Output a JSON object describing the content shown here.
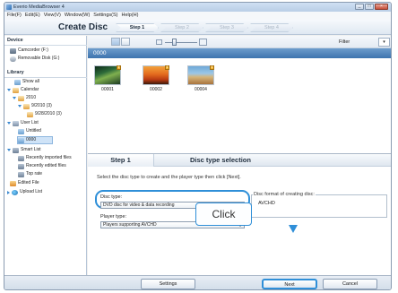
{
  "window": {
    "title": "Everio MediaBrowser 4",
    "controls": {
      "minimize": "_",
      "maximize": "□",
      "close": "×"
    }
  },
  "menu": [
    "File(F)",
    "Edit(E)",
    "View(V)",
    "Window(W)",
    "Settings(S)",
    "Help(H)"
  ],
  "header": {
    "mode_title": "Create Disc",
    "steps": [
      "Step 1",
      "Step 2",
      "Step 3",
      "Step 4"
    ],
    "active_step": 0
  },
  "sidebar": {
    "device_heading": "Device",
    "devices": [
      "Camcorder (F:)",
      "Removable Disk (G:)"
    ],
    "library_heading": "Library",
    "library": {
      "show_all": "Show all",
      "calendar": "Calendar",
      "year": "2010",
      "month": "9/2010 (3)",
      "day": "9/28/2010 (3)",
      "user_list": "User List",
      "untitled": "Untitled",
      "selected_folder": "0000",
      "smart_list": "Smart List",
      "recently_imported": "Recently imported files",
      "recently_edited": "Recently edited files",
      "top_rate": "Top rate",
      "edited_file": "Edited File",
      "upload_list": "Upload List"
    },
    "scroll_left": "◂",
    "scroll_right": "▸"
  },
  "toolbar": {
    "filter_label": "Filter",
    "filter_button": "▾"
  },
  "group": {
    "name": "0000"
  },
  "thumbnails": [
    {
      "caption": "00001",
      "badge": "1",
      "scene": "forest"
    },
    {
      "caption": "00002",
      "badge": "1",
      "scene": "sunset-plane"
    },
    {
      "caption": "00004",
      "badge": "1",
      "scene": "desert"
    }
  ],
  "step_panel": {
    "step_label": "Step 1",
    "heading": "Disc type selection",
    "instruction": "Select the disc type to create and the player type then click [Next].",
    "disc_type_label": "Disc type:",
    "disc_type_value": "DVD disc for video & data recording",
    "player_type_label": "Player type:",
    "player_type_value": "Players supporting AVCHD",
    "format_label": "Disc format of creating disc:",
    "format_value": "AVCHD"
  },
  "callout": {
    "text": "Click"
  },
  "buttons": {
    "settings": "Settings",
    "next": "Next",
    "cancel": "Cancel"
  },
  "colors": {
    "accent": "#2f8fd8",
    "group_bar": "#3e74ae",
    "title_bar": "#cfe0f3"
  }
}
